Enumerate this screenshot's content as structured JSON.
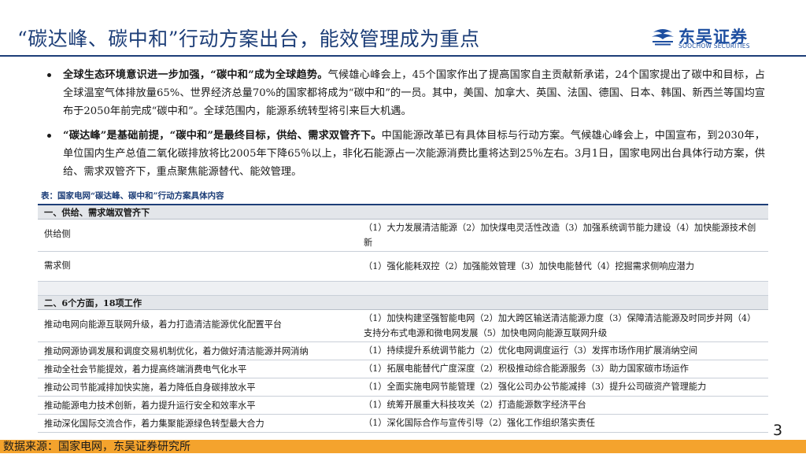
{
  "header": {
    "title": "“碳达峰、碳中和”行动方案出台，能效管理成为重点",
    "logo_cn": "东吴证券",
    "logo_en": "SOOCHOW SECURITIES"
  },
  "bullets": [
    {
      "lead": "全球生态环境意识进一步加强，“碳中和”成为全球趋势。",
      "text": "气候雄心峰会上，45个国家作出了提高国家自主贡献新承诺，24个国家提出了碳中和目标，占全球温室气体排放量65%、世界经济总量70%的国家都将成为“碳中和”的一员。其中，美国、加拿大、英国、法国、德国、日本、韩国、新西兰等国均宣布于2050年前完成“碳中和”。全球范围内，能源系统转型将引来巨大机遇。"
    },
    {
      "lead": "“碳达峰”是基础前提，“碳中和”是最终目标，供给、需求双管齐下。",
      "text": "中国能源改革已有具体目标与行动方案。气候雄心峰会上，中国宣布，到2030年，单位国内生产总值二氧化碳排放将比2005年下降65％以上，非化石能源占一次能源消费比重将达到25％左右。3月1日，国家电网出台具体行动方案，供给、需求双管齐下，重点聚焦能源替代、能效管理。"
    }
  ],
  "table": {
    "caption": "表：国家电网“碳达峰、碳中和”行动方案具体内容",
    "section1": {
      "heading": "一、供给、需求端双管齐下",
      "rows": [
        {
          "a": "供给侧",
          "b": "（1）大力发展清洁能源（2）加快煤电灵活性改造（3）加强系统调节能力建设（4）加快能源技术创新"
        },
        {
          "a": "需求侧",
          "b": "（1）强化能耗双控（2）加强能效管理（3）加快电能替代（4）挖掘需求侧响应潜力"
        }
      ]
    },
    "section2": {
      "heading": "二、6个方面，18项工作",
      "rows": [
        {
          "a": "推动电网向能源互联网升级，着力打造清洁能源优化配置平台",
          "b": "（1）加快构建坚强智能电网（2）加大跨区输送清洁能源力度（3）保障清洁能源及时同步并网（4）支持分布式电源和微电网发展（5）加快电网向能源互联网升级"
        },
        {
          "a": "推动网源协调发展和调度交易机制优化，着力做好清洁能源并网消纳",
          "b": "（1）持续提升系统调节能力（2）优化电网调度运行（3）发挥市场作用扩展消纳空间"
        },
        {
          "a": "推动全社会节能提效，着力提高终端消费电气化水平",
          "b": "（1）拓展电能替代广度深度（2）积极推动综合能源服务（3）助力国家碳市场运作"
        },
        {
          "a": "推动公司节能减排加快实施，着力降低自身碳排放水平",
          "b": "（1）全面实施电网节能管理（2）强化公司办公节能减排（3）提升公司碳资产管理能力"
        },
        {
          "a": "推动能源电力技术创新，着力提升运行安全和效率水平",
          "b": "（1）统筹开展重大科技攻关（2）打造能源数字经济平台"
        },
        {
          "a": "推动深化国际交流合作，着力集聚能源绿色转型最大合力",
          "b": "（1）深化国际合作与宣传引导（2）强化工作组织落实责任"
        }
      ]
    }
  },
  "footer": {
    "source": "数据来源：国家电网，东吴证券研究所",
    "page_number": "3"
  },
  "colors": {
    "brand_blue": "#1d3e78",
    "footer_orange": "#f4a32d",
    "section_gray": "#e3e6ea"
  }
}
